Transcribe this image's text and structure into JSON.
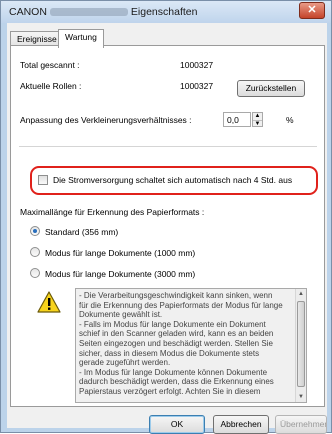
{
  "window": {
    "title_prefix": "CANON",
    "title_suffix": "Eigenschaften",
    "close_glyph": "✕"
  },
  "tabs": [
    {
      "label": "Ereignisse",
      "active": false
    },
    {
      "label": "Wartung",
      "active": true
    }
  ],
  "counters": {
    "total_label": "Total gescannt :",
    "total_value": "1000327",
    "rollers_label": "Aktuelle Rollen :",
    "rollers_value": "1000327",
    "reset_button": "Zurückstellen"
  },
  "reduction": {
    "label": "Anpassung des Verkleinerungsverhältnisses :",
    "value": "0,0",
    "unit": "%"
  },
  "power": {
    "label": "Die Stromversorgung schaltet sich automatisch nach 4 Std. aus",
    "checked": false,
    "highlight_color": "#e0211b"
  },
  "paper_length": {
    "label": "Maximallänge für Erkennung des Papierformats :",
    "options": [
      {
        "label": "Standard (356 mm)",
        "checked": true
      },
      {
        "label": "Modus für lange Dokumente (1000 mm)",
        "checked": false
      },
      {
        "label": "Modus für lange Dokumente (3000 mm)",
        "checked": false
      }
    ]
  },
  "warning": {
    "icon": "warning-triangle-icon",
    "lines": [
      "- Die Verarbeitungsgeschwindigkeit kann sinken, wenn",
      "für die Erkennung des Papierformats der Modus für lange",
      "Dokumente gewählt ist.",
      "- Falls im Modus für lange Dokumente ein Dokument",
      "schief in den Scanner geladen wird, kann es an beiden",
      "Seiten eingezogen und beschädigt werden. Stellen Sie",
      "sicher, dass in diesem Modus die Dokumente stets",
      "gerade zugeführt werden.",
      "- Im Modus für lange Dokumente können Dokumente",
      "dadurch beschädigt werden, dass die Erkennung eines",
      "Papierstaus verzögert erfolgt. Achten Sie in diesem"
    ]
  },
  "footer": {
    "ok": "OK",
    "cancel": "Abbrechen",
    "apply": "Übernehmen"
  }
}
